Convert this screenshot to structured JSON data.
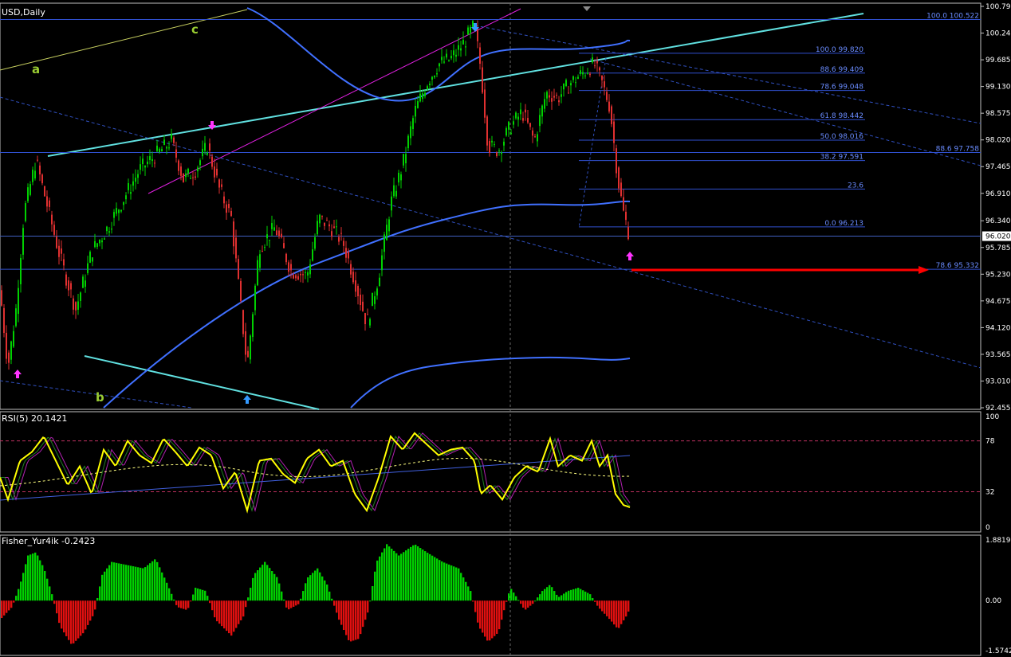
{
  "header": {
    "symbol_label": "USD,Daily"
  },
  "colors": {
    "background": "#000000",
    "frame": "#c0c0c0",
    "grid": "#1e1e1e",
    "axis_text": "#ffffff",
    "bull_candle": "#00d000",
    "bear_candle": "#e03030",
    "channel": "#60e0e0",
    "fib": "#3050d0",
    "ma": "#4070ff",
    "wave_label": "#9acd32",
    "arrow_blue": "#3399ff",
    "arrow_magenta": "#ff33ff",
    "target_arrow": "#ff0000",
    "rsi_line": "#ffff00",
    "rsi_level": "#c03060",
    "fisher_up": "#00d000",
    "fisher_down": "#e01010"
  },
  "chart_data": [
    {
      "type": "line",
      "name": "price",
      "title": "USD,Daily",
      "ylim": [
        92.455,
        100.795
      ],
      "y_ticks": [
        100.795,
        100.24,
        99.685,
        99.13,
        98.575,
        98.02,
        97.465,
        96.91,
        96.34,
        95.785,
        95.23,
        94.675,
        94.12,
        93.565,
        93.01,
        92.455
      ],
      "current_price": 96.02,
      "wave_labels": [
        "a",
        "b",
        "c"
      ],
      "fib_levels": [
        {
          "text": "100.0 100.522",
          "value": 100.522
        },
        {
          "text": "100.0 99.820",
          "value": 99.82
        },
        {
          "text": "88.6 99.409",
          "value": 99.409
        },
        {
          "text": "78.6 99.048",
          "value": 99.048
        },
        {
          "text": "61.8 98.442",
          "value": 98.442
        },
        {
          "text": "50.0 98.016",
          "value": 98.016
        },
        {
          "text": "38.2 97.591",
          "value": 97.591
        },
        {
          "text": "23.6",
          "value": 97.0
        },
        {
          "text": "0.0 96.213",
          "value": 96.213
        },
        {
          "text": "88.6 97.758",
          "value": 97.758
        },
        {
          "text": "78.6 95.332",
          "value": 95.332
        }
      ],
      "anchors": [
        {
          "x": 0,
          "y": 94.9
        },
        {
          "x": 10,
          "y": 93.3
        },
        {
          "x": 20,
          "y": 94.5
        },
        {
          "x": 30,
          "y": 96.5
        },
        {
          "x": 45,
          "y": 97.6
        },
        {
          "x": 60,
          "y": 96.6
        },
        {
          "x": 75,
          "y": 95.6
        },
        {
          "x": 95,
          "y": 94.5
        },
        {
          "x": 115,
          "y": 95.7
        },
        {
          "x": 135,
          "y": 96.2
        },
        {
          "x": 155,
          "y": 96.8
        },
        {
          "x": 175,
          "y": 97.4
        },
        {
          "x": 195,
          "y": 97.7
        },
        {
          "x": 215,
          "y": 98.0
        },
        {
          "x": 230,
          "y": 97.2
        },
        {
          "x": 245,
          "y": 97.4
        },
        {
          "x": 260,
          "y": 97.9
        },
        {
          "x": 275,
          "y": 97.0
        },
        {
          "x": 290,
          "y": 96.4
        },
        {
          "x": 310,
          "y": 93.3
        },
        {
          "x": 325,
          "y": 95.8
        },
        {
          "x": 345,
          "y": 96.2
        },
        {
          "x": 365,
          "y": 95.3
        },
        {
          "x": 385,
          "y": 95.2
        },
        {
          "x": 400,
          "y": 96.4
        },
        {
          "x": 415,
          "y": 96.2
        },
        {
          "x": 430,
          "y": 95.9
        },
        {
          "x": 445,
          "y": 95.1
        },
        {
          "x": 460,
          "y": 94.2
        },
        {
          "x": 475,
          "y": 95.2
        },
        {
          "x": 490,
          "y": 96.7
        },
        {
          "x": 505,
          "y": 97.5
        },
        {
          "x": 520,
          "y": 98.6
        },
        {
          "x": 535,
          "y": 99.2
        },
        {
          "x": 550,
          "y": 99.6
        },
        {
          "x": 565,
          "y": 99.7
        },
        {
          "x": 580,
          "y": 100.0
        },
        {
          "x": 595,
          "y": 100.4
        },
        {
          "x": 603,
          "y": 99.5
        },
        {
          "x": 612,
          "y": 97.9
        },
        {
          "x": 625,
          "y": 97.8
        },
        {
          "x": 640,
          "y": 98.3
        },
        {
          "x": 655,
          "y": 98.6
        },
        {
          "x": 670,
          "y": 98.0
        },
        {
          "x": 685,
          "y": 99.0
        },
        {
          "x": 700,
          "y": 98.9
        },
        {
          "x": 715,
          "y": 99.2
        },
        {
          "x": 730,
          "y": 99.4
        },
        {
          "x": 745,
          "y": 99.6
        },
        {
          "x": 755,
          "y": 99.2
        },
        {
          "x": 765,
          "y": 98.7
        },
        {
          "x": 775,
          "y": 97.2
        },
        {
          "x": 782,
          "y": 96.5
        },
        {
          "x": 790,
          "y": 96.0
        }
      ]
    },
    {
      "type": "line",
      "name": "rsi",
      "label": "RSI(5) 20.1421",
      "ylim": [
        0,
        100
      ],
      "y_ticks": [
        100,
        78,
        32,
        0
      ],
      "levels": [
        78,
        32
      ],
      "anchors": [
        {
          "x": 0,
          "y": 45
        },
        {
          "x": 10,
          "y": 25
        },
        {
          "x": 25,
          "y": 60
        },
        {
          "x": 40,
          "y": 68
        },
        {
          "x": 55,
          "y": 82
        },
        {
          "x": 70,
          "y": 60
        },
        {
          "x": 85,
          "y": 38
        },
        {
          "x": 100,
          "y": 55
        },
        {
          "x": 115,
          "y": 30
        },
        {
          "x": 130,
          "y": 70
        },
        {
          "x": 145,
          "y": 55
        },
        {
          "x": 160,
          "y": 78
        },
        {
          "x": 175,
          "y": 65
        },
        {
          "x": 190,
          "y": 58
        },
        {
          "x": 205,
          "y": 80
        },
        {
          "x": 220,
          "y": 68
        },
        {
          "x": 235,
          "y": 55
        },
        {
          "x": 250,
          "y": 72
        },
        {
          "x": 265,
          "y": 65
        },
        {
          "x": 280,
          "y": 35
        },
        {
          "x": 295,
          "y": 50
        },
        {
          "x": 310,
          "y": 15
        },
        {
          "x": 325,
          "y": 60
        },
        {
          "x": 340,
          "y": 62
        },
        {
          "x": 355,
          "y": 48
        },
        {
          "x": 370,
          "y": 40
        },
        {
          "x": 385,
          "y": 62
        },
        {
          "x": 400,
          "y": 70
        },
        {
          "x": 415,
          "y": 55
        },
        {
          "x": 430,
          "y": 60
        },
        {
          "x": 445,
          "y": 30
        },
        {
          "x": 460,
          "y": 15
        },
        {
          "x": 475,
          "y": 45
        },
        {
          "x": 490,
          "y": 82
        },
        {
          "x": 505,
          "y": 70
        },
        {
          "x": 520,
          "y": 85
        },
        {
          "x": 535,
          "y": 75
        },
        {
          "x": 550,
          "y": 65
        },
        {
          "x": 565,
          "y": 70
        },
        {
          "x": 580,
          "y": 72
        },
        {
          "x": 595,
          "y": 60
        },
        {
          "x": 603,
          "y": 30
        },
        {
          "x": 615,
          "y": 38
        },
        {
          "x": 630,
          "y": 25
        },
        {
          "x": 645,
          "y": 45
        },
        {
          "x": 660,
          "y": 55
        },
        {
          "x": 675,
          "y": 50
        },
        {
          "x": 690,
          "y": 80
        },
        {
          "x": 700,
          "y": 55
        },
        {
          "x": 715,
          "y": 65
        },
        {
          "x": 730,
          "y": 60
        },
        {
          "x": 742,
          "y": 78
        },
        {
          "x": 752,
          "y": 55
        },
        {
          "x": 762,
          "y": 65
        },
        {
          "x": 772,
          "y": 30
        },
        {
          "x": 782,
          "y": 20
        },
        {
          "x": 790,
          "y": 18
        }
      ]
    },
    {
      "type": "bar",
      "name": "fisher",
      "label": "Fisher_Yur4ik -0.2423",
      "ylim": [
        -1.5742,
        1.8819
      ],
      "y_ticks": [
        1.8819,
        0.0,
        -1.5742
      ],
      "anchors": [
        {
          "x": 0,
          "y": -0.6
        },
        {
          "x": 15,
          "y": -0.2
        },
        {
          "x": 25,
          "y": 0.5
        },
        {
          "x": 35,
          "y": 1.4
        },
        {
          "x": 45,
          "y": 1.5
        },
        {
          "x": 55,
          "y": 1.0
        },
        {
          "x": 65,
          "y": 0.2
        },
        {
          "x": 75,
          "y": -0.8
        },
        {
          "x": 90,
          "y": -1.4
        },
        {
          "x": 105,
          "y": -1.0
        },
        {
          "x": 118,
          "y": -0.4
        },
        {
          "x": 128,
          "y": 0.8
        },
        {
          "x": 140,
          "y": 1.2
        },
        {
          "x": 160,
          "y": 1.1
        },
        {
          "x": 180,
          "y": 1.0
        },
        {
          "x": 195,
          "y": 1.3
        },
        {
          "x": 210,
          "y": 0.5
        },
        {
          "x": 222,
          "y": -0.2
        },
        {
          "x": 235,
          "y": -0.3
        },
        {
          "x": 245,
          "y": 0.4
        },
        {
          "x": 258,
          "y": 0.3
        },
        {
          "x": 270,
          "y": -0.6
        },
        {
          "x": 290,
          "y": -1.1
        },
        {
          "x": 305,
          "y": -0.5
        },
        {
          "x": 318,
          "y": 0.8
        },
        {
          "x": 332,
          "y": 1.2
        },
        {
          "x": 348,
          "y": 0.7
        },
        {
          "x": 360,
          "y": -0.3
        },
        {
          "x": 375,
          "y": -0.1
        },
        {
          "x": 385,
          "y": 0.7
        },
        {
          "x": 398,
          "y": 1.0
        },
        {
          "x": 410,
          "y": 0.5
        },
        {
          "x": 425,
          "y": -0.6
        },
        {
          "x": 438,
          "y": -1.3
        },
        {
          "x": 450,
          "y": -1.2
        },
        {
          "x": 462,
          "y": -0.3
        },
        {
          "x": 472,
          "y": 1.2
        },
        {
          "x": 485,
          "y": 1.75
        },
        {
          "x": 500,
          "y": 1.4
        },
        {
          "x": 520,
          "y": 1.75
        },
        {
          "x": 535,
          "y": 1.5
        },
        {
          "x": 555,
          "y": 1.2
        },
        {
          "x": 575,
          "y": 1.0
        },
        {
          "x": 590,
          "y": 0.3
        },
        {
          "x": 600,
          "y": -0.8
        },
        {
          "x": 612,
          "y": -1.3
        },
        {
          "x": 625,
          "y": -1.0
        },
        {
          "x": 632,
          "y": -0.3
        },
        {
          "x": 640,
          "y": 0.4
        },
        {
          "x": 648,
          "y": 0.1
        },
        {
          "x": 658,
          "y": -0.3
        },
        {
          "x": 668,
          "y": -0.1
        },
        {
          "x": 680,
          "y": 0.3
        },
        {
          "x": 690,
          "y": 0.5
        },
        {
          "x": 700,
          "y": 0.1
        },
        {
          "x": 712,
          "y": 0.3
        },
        {
          "x": 725,
          "y": 0.4
        },
        {
          "x": 740,
          "y": 0.2
        },
        {
          "x": 750,
          "y": -0.2
        },
        {
          "x": 765,
          "y": -0.6
        },
        {
          "x": 775,
          "y": -0.9
        },
        {
          "x": 785,
          "y": -0.5
        },
        {
          "x": 790,
          "y": -0.24
        }
      ]
    }
  ]
}
